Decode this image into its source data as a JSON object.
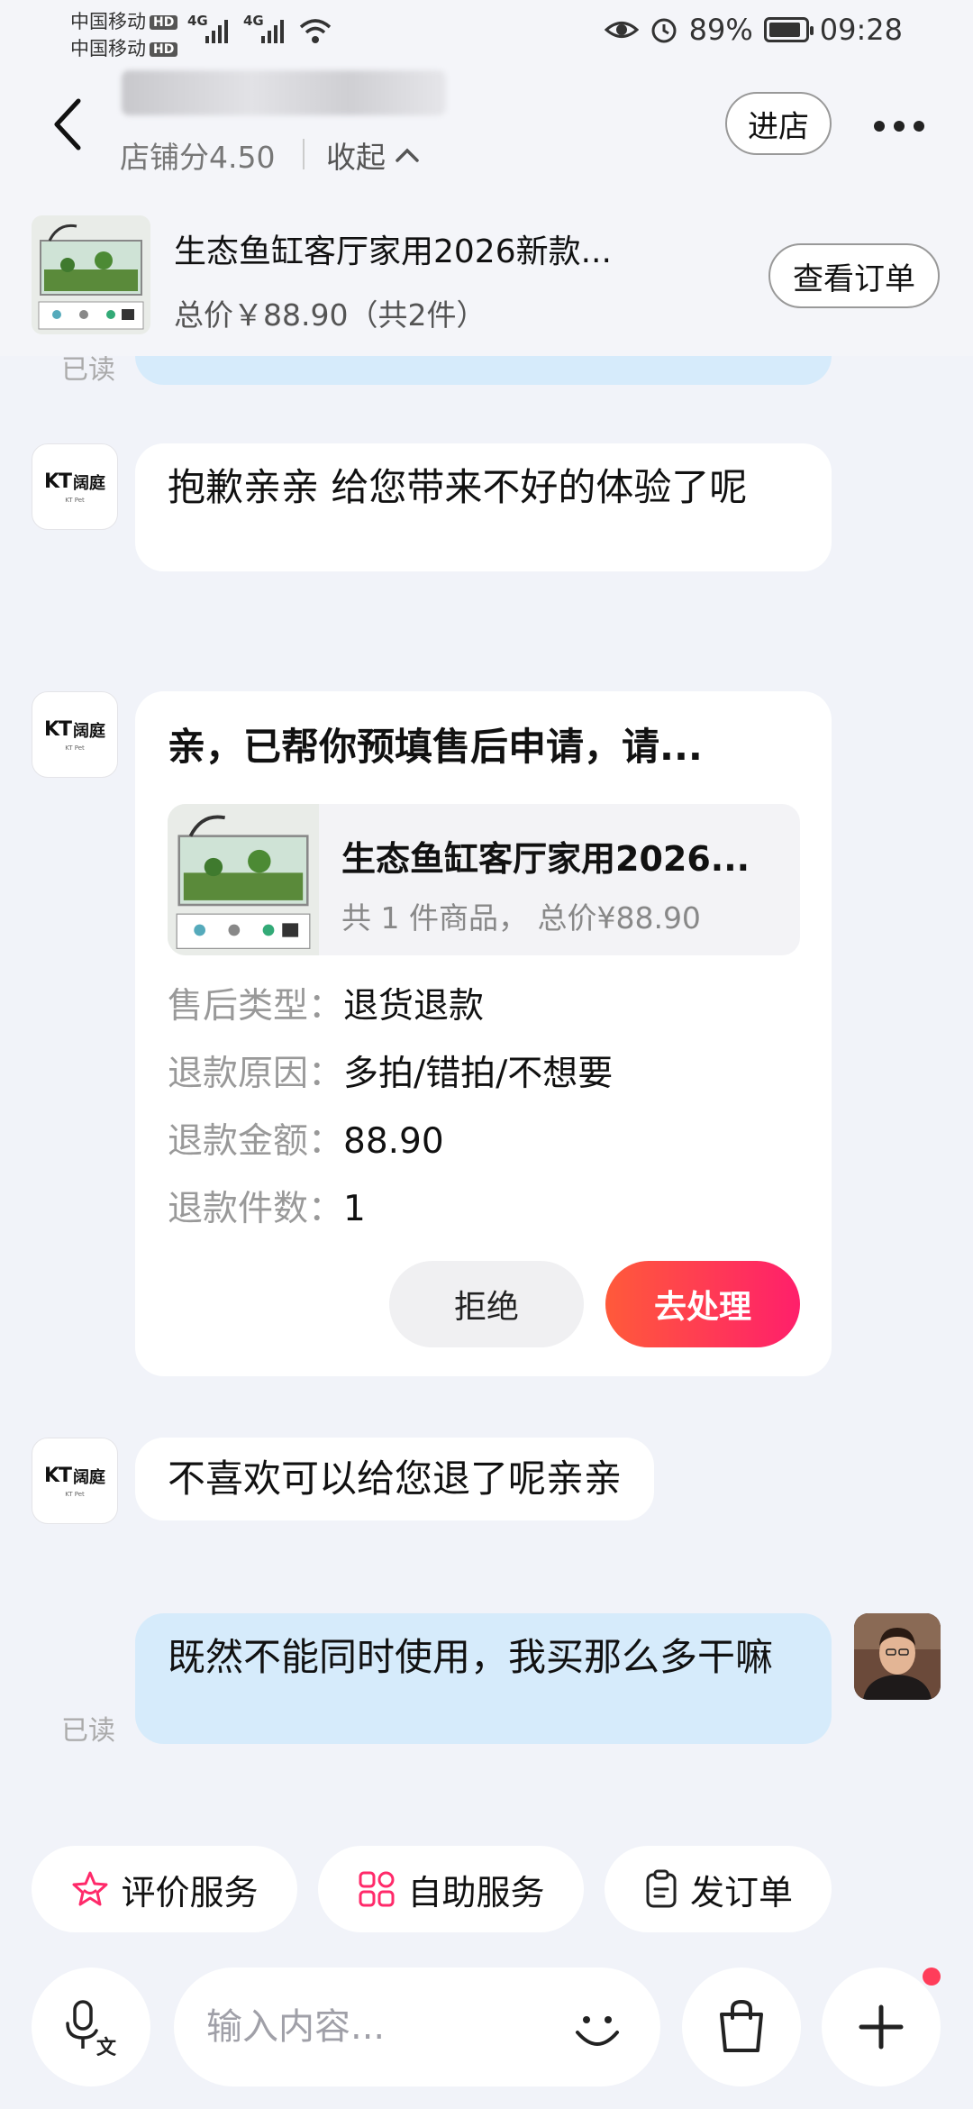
{
  "status_bar": {
    "carrier1": "中国移动",
    "carrier2": "中国移动",
    "hd": "HD",
    "net1": "4G",
    "net2": "4G",
    "battery": "89%",
    "battery_level": 0.89,
    "time": "09:28"
  },
  "header": {
    "shop_score": "店铺分4.50",
    "collapse": "收起",
    "enter_shop": "进店"
  },
  "order": {
    "title": "生态鱼缸客厅家用2026新款...",
    "total": "总价￥88.90（共2件）",
    "view_order": "查看订单"
  },
  "chat": {
    "partial_read": "已读",
    "msg1": "抱歉亲亲 给您带来不好的体验了呢",
    "msg2": "不喜欢可以给您退了呢亲亲",
    "user_msg": "既然不能同时使用，我买那么多干嘛",
    "user_read": "已读"
  },
  "aftersale_card": {
    "title": "亲，已帮你预填售后申请，请...",
    "product_name": "生态鱼缸客厅家用2026...",
    "product_meta": "共 1 件商品，  总价¥88.90",
    "type_label": "售后类型：",
    "type_value": "退货退款",
    "reason_label": "退款原因：",
    "reason_value": "多拍/错拍/不想要",
    "amount_label": "退款金额：",
    "amount_value": "88.90",
    "count_label": "退款件数：",
    "count_value": "1",
    "reject": "拒绝",
    "handle": "去处理"
  },
  "shop_logo": {
    "mark": "KT",
    "cn": "阔庭",
    "sub": "KT Pet"
  },
  "quick_actions": {
    "rate": "评价服务",
    "self_service": "自助服务",
    "send_order": "发订单"
  },
  "input": {
    "placeholder": "输入内容..."
  },
  "colors": {
    "user_bubble": "#d6ebfb",
    "accent_start": "#ff5a3a",
    "accent_end": "#ff1f6b",
    "background": "#f1f3f9"
  }
}
